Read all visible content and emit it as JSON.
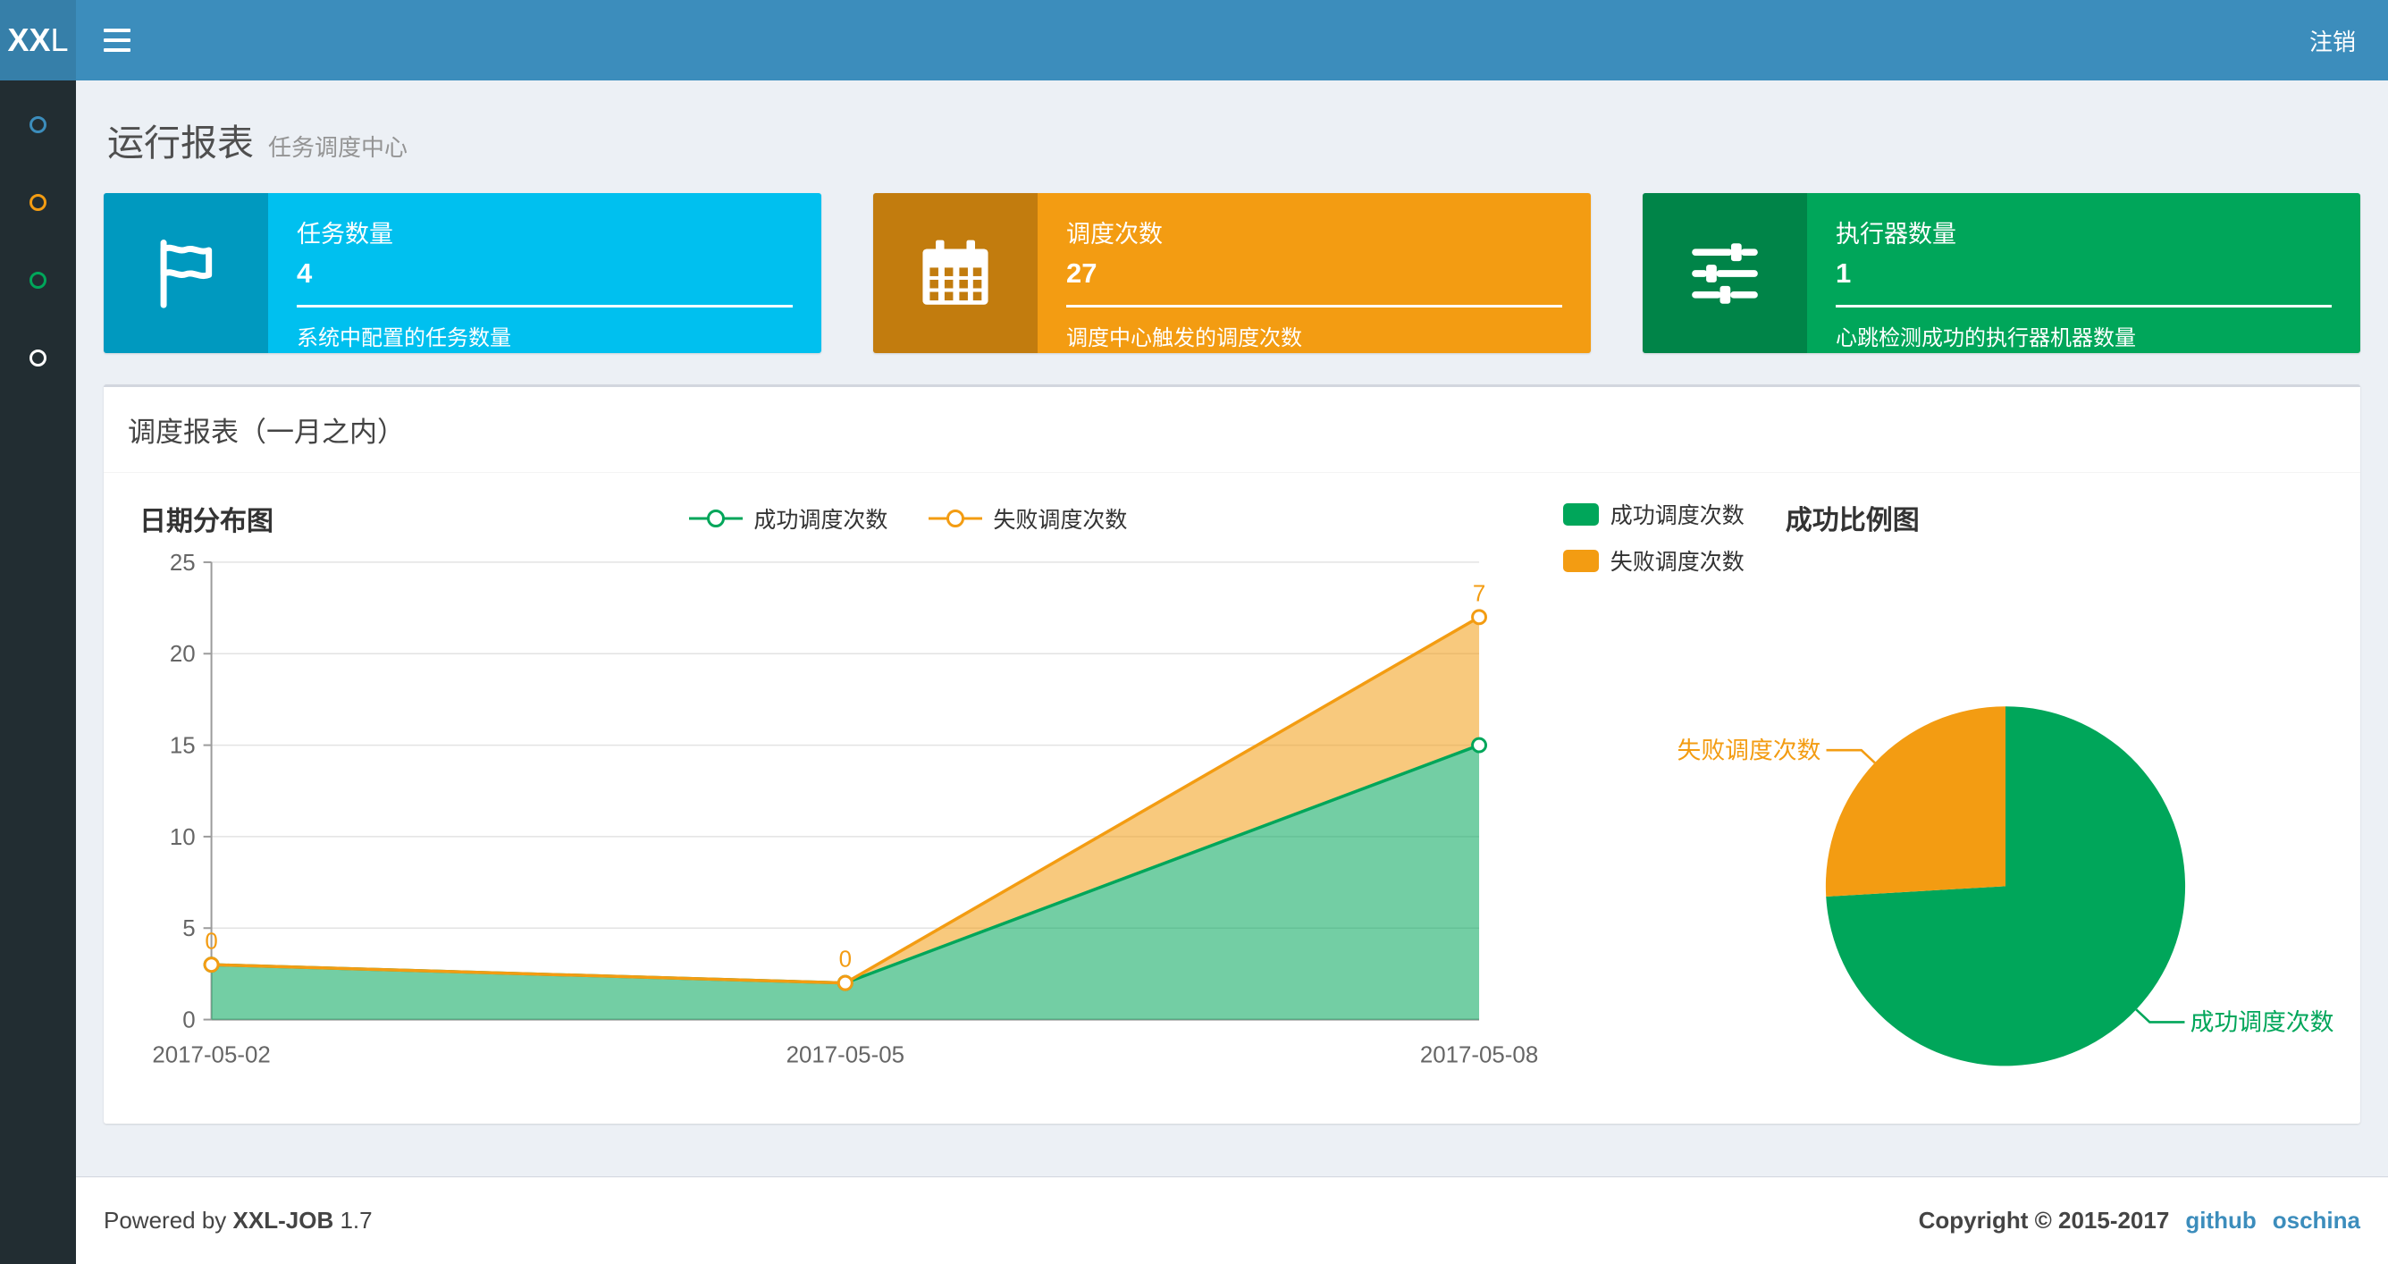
{
  "navbar": {
    "logo_bold": "XX",
    "logo_rest": "L",
    "logout_label": "注销"
  },
  "sidebar": {
    "items": [
      {
        "color": "#3c8dbc"
      },
      {
        "color": "#f39c12"
      },
      {
        "color": "#00a65a"
      },
      {
        "color": "#ffffff"
      }
    ]
  },
  "header": {
    "title": "运行报表",
    "subtitle": "任务调度中心"
  },
  "info_boxes": [
    {
      "label": "任务数量",
      "value": "4",
      "desc": "系统中配置的任务数量",
      "color": "#00c0ef",
      "icon": "flag-icon"
    },
    {
      "label": "调度次数",
      "value": "27",
      "desc": "调度中心触发的调度次数",
      "color": "#f39c12",
      "icon": "calendar-icon"
    },
    {
      "label": "执行器数量",
      "value": "1",
      "desc": "心跳检测成功的执行器机器数量",
      "color": "#00a65a",
      "icon": "sliders-icon"
    }
  ],
  "panel": {
    "title": "调度报表（一月之内）"
  },
  "chart_data": [
    {
      "type": "area",
      "title": "日期分布图",
      "x": [
        "2017-05-02",
        "2017-05-05",
        "2017-05-08"
      ],
      "series": [
        {
          "name": "成功调度次数",
          "values": [
            3,
            2,
            15
          ],
          "color": "#00a65a",
          "show_labels": false
        },
        {
          "name": "失败调度次数",
          "values": [
            0,
            0,
            7
          ],
          "color": "#f39c12",
          "show_labels": true
        }
      ],
      "stacked": true,
      "xlabel": "",
      "ylabel": "",
      "ylim": [
        0,
        25
      ],
      "yticks": [
        0,
        5,
        10,
        15,
        20,
        25
      ],
      "grid": true,
      "legend_position": "top-center"
    },
    {
      "type": "pie",
      "title": "成功比例图",
      "slices": [
        {
          "label": "成功调度次数",
          "value": 20,
          "color": "#00a65a"
        },
        {
          "label": "失败调度次数",
          "value": 7,
          "color": "#f39c12"
        }
      ],
      "legend_position": "top-left"
    }
  ],
  "footer": {
    "powered_prefix": "Powered by",
    "product": "XXL-JOB",
    "version": "1.7",
    "copyright": "Copyright © 2015-2017",
    "links": [
      {
        "label": "github"
      },
      {
        "label": "oschina"
      }
    ]
  }
}
